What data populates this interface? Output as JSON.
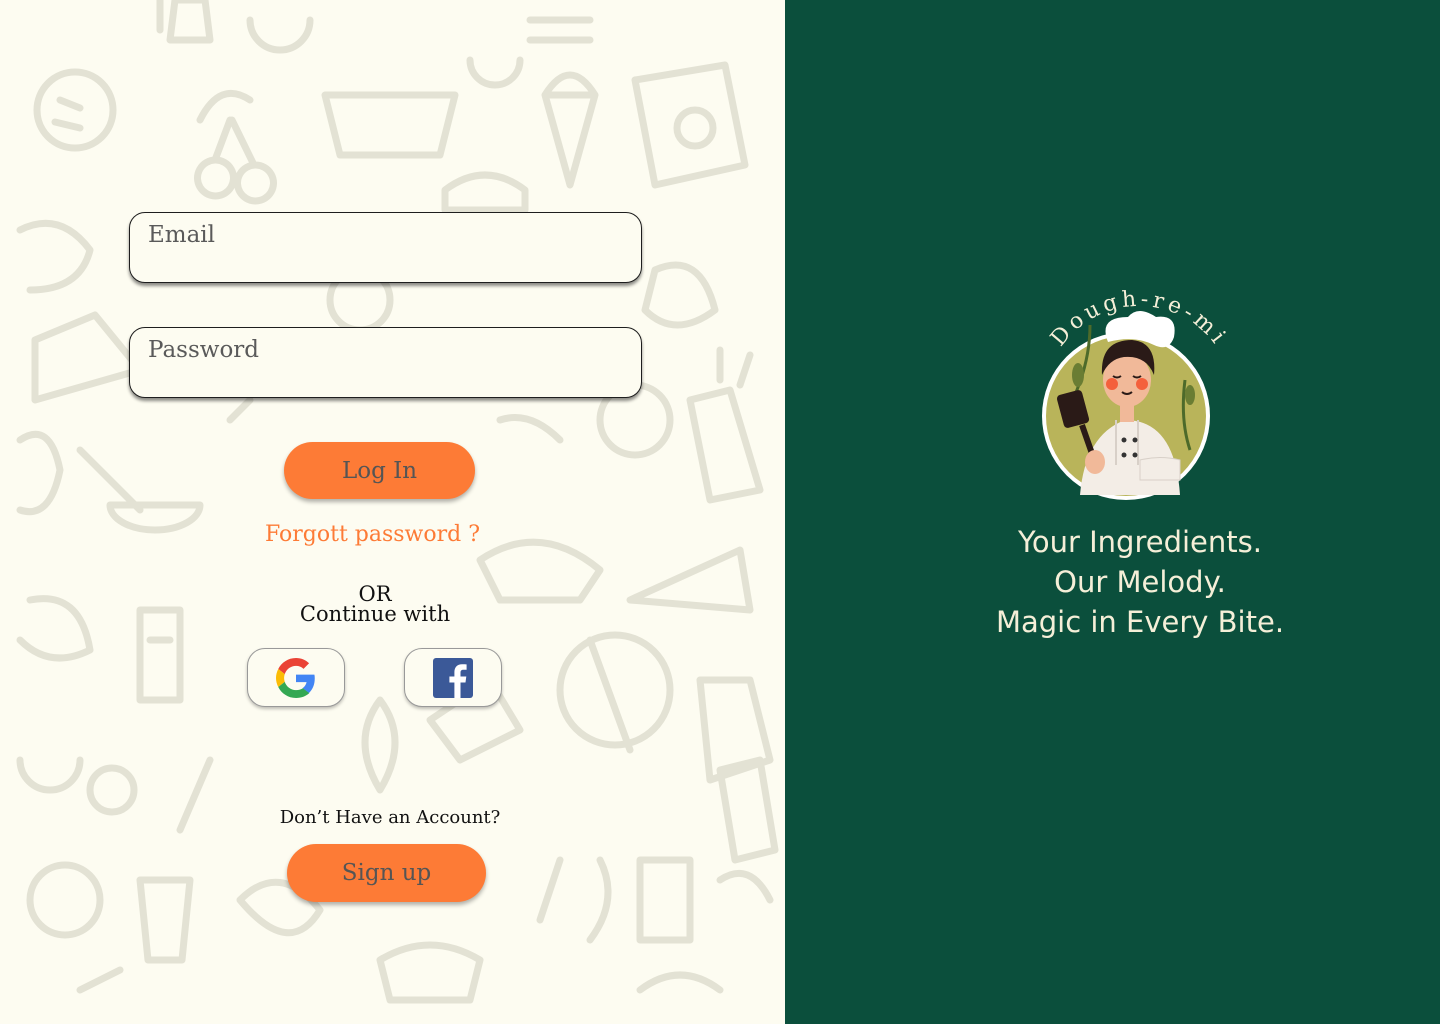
{
  "login_form": {
    "email_placeholder": "Email",
    "password_placeholder": "Password",
    "login_label": "Log In",
    "forgot_label": "Forgott password ?",
    "or_label": "OR",
    "continue_label": "Continue with",
    "google_icon": "google-icon",
    "facebook_icon": "facebook-icon",
    "no_account_label": "Don’t Have an Account?",
    "signup_label": "Sign up"
  },
  "brand": {
    "name": "Dough-re-mi",
    "tagline": [
      "Your Ingredients.",
      "Our Melody.",
      "Magic in Every Bite."
    ]
  },
  "colors": {
    "left_bg": "#fdfcf1",
    "right_bg": "#0b4f3c",
    "accent": "#fd7b36",
    "tagline": "#f5efd8"
  }
}
